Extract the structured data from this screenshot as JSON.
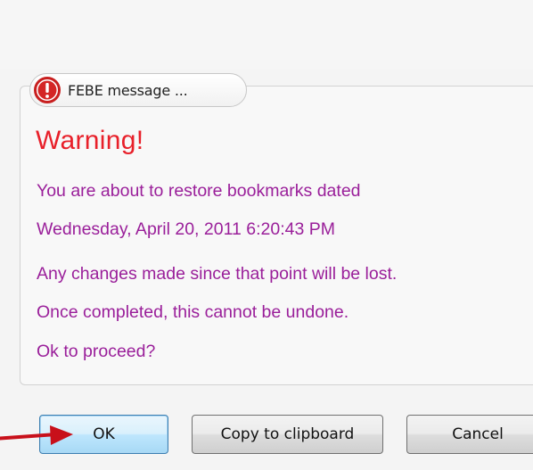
{
  "dialog": {
    "title": "FEBE message ...",
    "heading": "Warning!",
    "message_lines": [
      "You are about to restore bookmarks dated",
      "Wednesday, April 20, 2011 6:20:43 PM",
      "Any changes made since that point will be lost.",
      "Once completed, this cannot be undone.",
      "Ok to proceed?"
    ],
    "buttons": {
      "ok_label": "OK",
      "copy_label": "Copy to clipboard",
      "cancel_label": "Cancel"
    }
  },
  "icons": {
    "title_icon": "warning-exclamation-icon",
    "pointer": "red-arrow-pointer-icon"
  },
  "colors": {
    "heading": "#e8202a",
    "message_text": "#9a1f9a",
    "warning_icon": "#c81f1f",
    "arrow": "#c8101a"
  }
}
